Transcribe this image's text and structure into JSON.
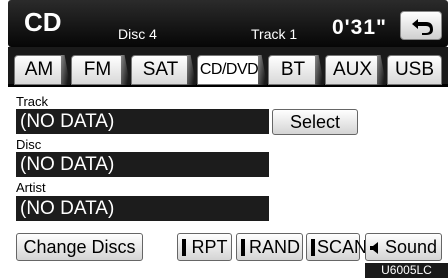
{
  "header": {
    "source": "CD",
    "disc": "Disc 4",
    "track": "Track   1",
    "time": "0'31\""
  },
  "tabs": [
    {
      "label": "AM"
    },
    {
      "label": "FM"
    },
    {
      "label": "SAT"
    },
    {
      "label": "CD/DVD",
      "active": true
    },
    {
      "label": "BT"
    },
    {
      "label": "AUX"
    },
    {
      "label": "USB"
    }
  ],
  "fields": {
    "track": {
      "label": "Track",
      "value": "(NO DATA)"
    },
    "disc": {
      "label": "Disc",
      "value": "(NO DATA)"
    },
    "artist": {
      "label": "Artist",
      "value": "(NO DATA)"
    }
  },
  "buttons": {
    "select": "Select",
    "change_discs": "Change Discs",
    "rpt": "RPT",
    "rand": "RAND",
    "scan": "SCAN",
    "sound": "Sound"
  },
  "footer": {
    "model_code": "U6005LC"
  }
}
